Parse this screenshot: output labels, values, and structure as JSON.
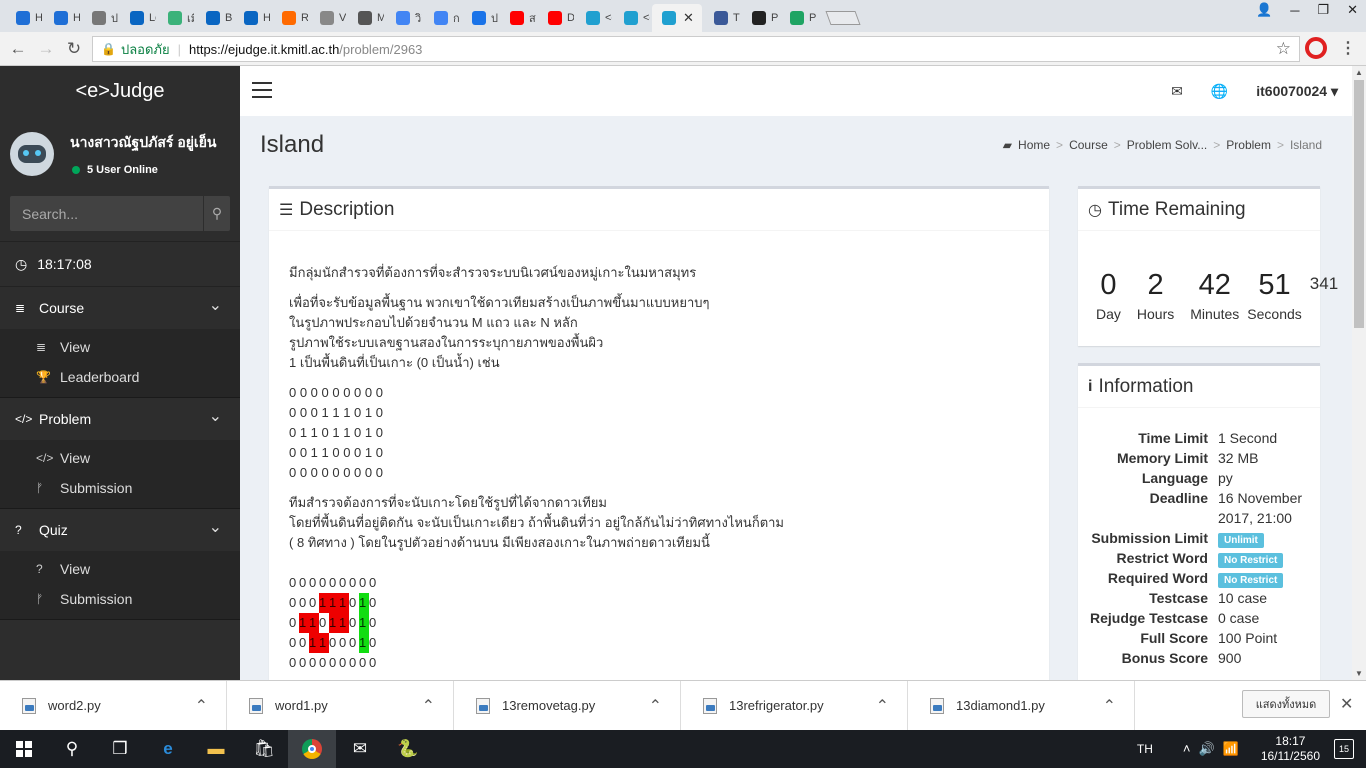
{
  "browser": {
    "tabs": [
      {
        "label": "Ha",
        "icon": "blue-h-icon",
        "color": "#1f6fd6"
      },
      {
        "label": "Ha",
        "icon": "blue-h-icon",
        "color": "#1f6fd6"
      },
      {
        "label": "ประ",
        "icon": "history-icon",
        "color": "#777777"
      },
      {
        "label": "Lea",
        "icon": "linkedin-icon",
        "color": "#0a66c2"
      },
      {
        "label": "เมือ",
        "icon": "map-icon",
        "color": "#3bb27a"
      },
      {
        "label": "Bo",
        "icon": "linkedin-icon",
        "color": "#0a66c2"
      },
      {
        "label": "HTI",
        "icon": "linkedin-icon",
        "color": "#0a66c2"
      },
      {
        "label": "Ro",
        "icon": "runner-icon",
        "color": "#ff6a00"
      },
      {
        "label": "Ver",
        "icon": "document-icon",
        "color": "#888888"
      },
      {
        "label": "Ma",
        "icon": "page-icon",
        "color": "#555555"
      },
      {
        "label": "วิธี",
        "icon": "google-icon",
        "color": "#4285f4"
      },
      {
        "label": "การ",
        "icon": "google-icon",
        "color": "#4285f4"
      },
      {
        "label": "ปรั",
        "icon": "app-icon",
        "color": "#1a73e8"
      },
      {
        "label": "สอน",
        "icon": "youtube-icon",
        "color": "#ff0000"
      },
      {
        "label": "DJ",
        "icon": "youtube-icon",
        "color": "#ff0000"
      },
      {
        "label": "<e",
        "icon": "ejudge-icon",
        "color": "#20a0d0"
      },
      {
        "label": "<e",
        "icon": "ejudge-icon",
        "color": "#20a0d0"
      },
      {
        "label": "",
        "icon": "ejudge-icon",
        "color": "#20a0d0",
        "active": true
      },
      {
        "label": "Tha",
        "icon": "facebook-icon",
        "color": "#3b5998"
      },
      {
        "label": "PSU",
        "icon": "github-icon",
        "color": "#222222"
      },
      {
        "label": "PSU",
        "icon": "drive-icon",
        "color": "#1fa463"
      }
    ],
    "secure_label": "ปลอดภัย",
    "url_host": "https://ejudge.it.kmitl.ac.th",
    "url_path": "/problem/2963"
  },
  "sidebar": {
    "brand": "<e>Judge",
    "user_name": "นางสาวณัฐปภัสร์ อยู่เย็น",
    "online_text": "5 User Online",
    "search_placeholder": "Search...",
    "clock": "18:17:08",
    "sections": [
      {
        "label": "Course",
        "icon": "list-icon",
        "items": [
          {
            "label": "View",
            "icon": "list-icon"
          },
          {
            "label": "Leaderboard",
            "icon": "trophy-icon"
          }
        ]
      },
      {
        "label": "Problem",
        "icon": "code-icon",
        "items": [
          {
            "label": "View",
            "icon": "code-icon"
          },
          {
            "label": "Submission",
            "icon": "branch-icon"
          }
        ]
      },
      {
        "label": "Quiz",
        "icon": "question-icon",
        "items": [
          {
            "label": "View",
            "icon": "question-icon"
          },
          {
            "label": "Submission",
            "icon": "branch-icon"
          }
        ]
      }
    ]
  },
  "topbar": {
    "username": "it60070024"
  },
  "page": {
    "title": "Island",
    "breadcrumb": [
      "Home",
      "Course",
      "Problem Solv...",
      "Problem",
      "Island"
    ]
  },
  "description": {
    "heading": "Description",
    "p1": "มีกลุ่มนักสำรวจที่ต้องการที่จะสำรวจระบบนิเวศน์ของหมู่เกาะในมหาสมุทร",
    "p2_lines": [
      "เพื่อที่จะรับข้อมูลพื้นฐาน พวกเขาใช้ดาวเทียมสร้างเป็นภาพขึ้นมาแบบหยาบๆ",
      "ในรูปภาพประกอบไปด้วยจำนวน M แถว และ N หลัก",
      "รูปภาพใช้ระบบเลขฐานสองในการระบุกายภาพของพื้นผิว",
      "1 เป็นพื้นดินที่เป็นเกาะ (0 เป็นน้ำ) เช่น"
    ],
    "grid1": [
      "0 0 0 0 0 0 0 0 0",
      "0 0 0 1 1 1 0 1 0",
      "0 1 1 0 1 1 0 1 0",
      "0 0 1 1 0 0 0 1 0",
      "0 0 0 0 0 0 0 0 0"
    ],
    "p3_lines": [
      "ทีมสำรวจต้องการที่จะนับเกาะโดยใช้รูปที่ได้จากดาวเทียม",
      "โดยที่พื้นดินที่อยู่ติดกัน จะนับเป็นเกาะเดียว ถ้าพื้นดินที่ว่า อยู่ใกล้กันไม่ว่าทิศทางไหนก็ตาม",
      "( 8 ทิศทาง ) โดยในรูปตัวอย่างด้านบน มีเพียงสองเกาะในภาพถ่ายดาวเทียมนี้"
    ],
    "grid2": [
      [
        "0",
        "0",
        "0",
        "0",
        "0",
        "0",
        "0",
        "0",
        "0"
      ],
      [
        "0",
        "0",
        "0",
        "1r",
        "1r",
        "1r",
        "0",
        "1g",
        "0"
      ],
      [
        "0",
        "1r",
        "1r",
        "0",
        "1r",
        "1r",
        "0",
        "1g",
        "0"
      ],
      [
        "0",
        "0",
        "1r",
        "1r",
        "0",
        "0",
        "0",
        "1g",
        "0"
      ],
      [
        "0",
        "0",
        "0",
        "0",
        "0",
        "0",
        "0",
        "0",
        "0"
      ]
    ]
  },
  "time_remaining": {
    "heading": "Time Remaining",
    "day": "0",
    "hours": "2",
    "minutes": "42",
    "seconds": "51",
    "ms": "341",
    "day_label": "Day",
    "hours_label": "Hours",
    "minutes_label": "Minutes",
    "seconds_label": "Seconds"
  },
  "information": {
    "heading": "Information",
    "rows": [
      {
        "key": "Time Limit",
        "value": "1 Second"
      },
      {
        "key": "Memory Limit",
        "value": "32 MB"
      },
      {
        "key": "Language",
        "value": "py"
      },
      {
        "key": "Deadline",
        "value": "16 November 2017, 21:00"
      },
      {
        "key": "Submission Limit",
        "badge": "Unlimit"
      },
      {
        "key": "Restrict Word",
        "badge": "No Restrict"
      },
      {
        "key": "Required Word",
        "badge": "No Restrict"
      },
      {
        "key": "Testcase",
        "value": "10 case"
      },
      {
        "key": "Rejudge Testcase",
        "value": "0 case"
      },
      {
        "key": "Full Score",
        "value": "100 Point"
      },
      {
        "key": "Bonus Score",
        "value": "900"
      }
    ]
  },
  "downloads": {
    "files": [
      "word2.py",
      "word1.py",
      "13removetag.py",
      "13refrigerator.py",
      "13diamond1.py"
    ],
    "show_all": "แสดงทั้งหมด"
  },
  "taskbar": {
    "lang": "TH",
    "time": "18:17",
    "date": "16/11/2560",
    "notifications": "15"
  }
}
